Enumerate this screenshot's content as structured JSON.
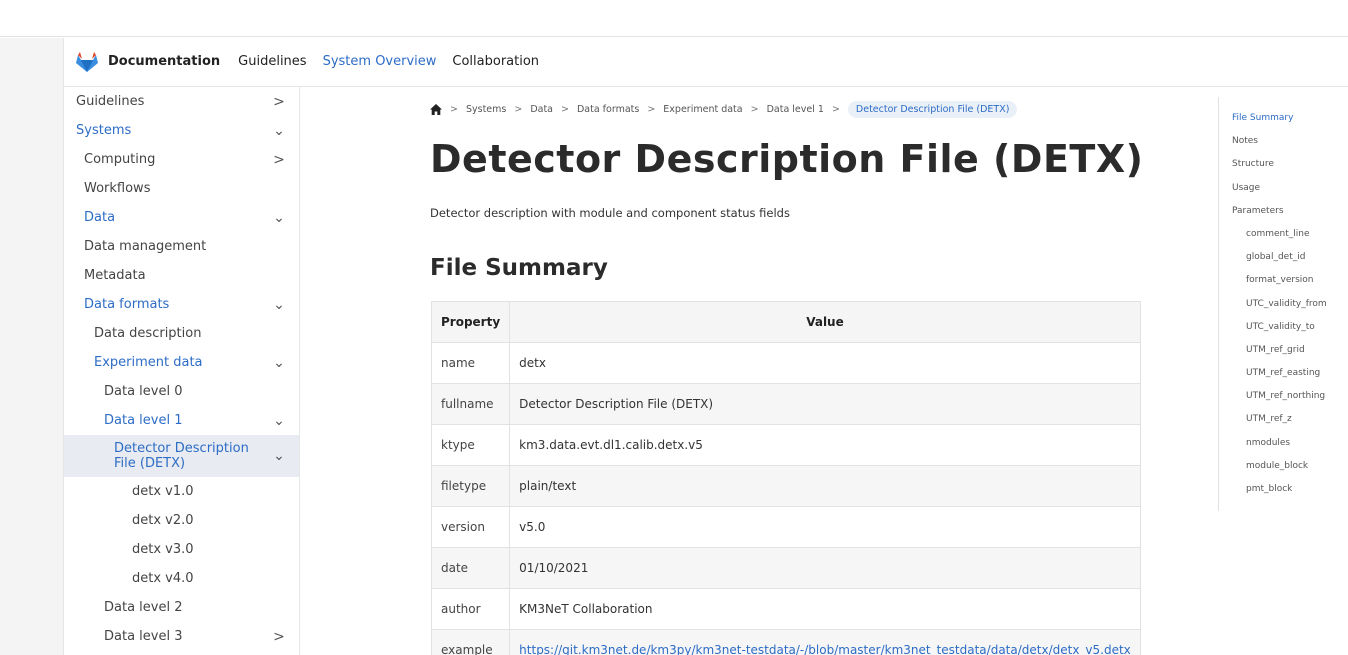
{
  "topnav": {
    "brand": "Documentation",
    "links": [
      {
        "label": "Guidelines",
        "active": false
      },
      {
        "label": "System Overview",
        "active": true
      },
      {
        "label": "Collaboration",
        "active": false
      }
    ]
  },
  "sidebar": {
    "items": [
      {
        "label": "Guidelines",
        "chevron": ">",
        "level": 0,
        "active": false
      },
      {
        "label": "Systems",
        "chevron": "⌄",
        "level": 0,
        "active": true
      },
      {
        "label": "Computing",
        "chevron": ">",
        "level": 1,
        "active": false
      },
      {
        "label": "Workflows",
        "chevron": "",
        "level": 1,
        "active": false
      },
      {
        "label": "Data",
        "chevron": "⌄",
        "level": 1,
        "active": true
      },
      {
        "label": "Data management",
        "chevron": "",
        "level": 2,
        "active": false
      },
      {
        "label": "Metadata",
        "chevron": "",
        "level": 2,
        "active": false
      },
      {
        "label": "Data formats",
        "chevron": "⌄",
        "level": 2,
        "active": true
      },
      {
        "label": "Data description",
        "chevron": "",
        "level": 3,
        "active": false
      },
      {
        "label": "Experiment data",
        "chevron": "⌄",
        "level": 3,
        "active": true
      },
      {
        "label": "Data level 0",
        "chevron": "",
        "level": 4,
        "active": false
      },
      {
        "label": "Data level 1",
        "chevron": "⌄",
        "level": 4,
        "active": true
      },
      {
        "label": "Detector Description File (DETX)",
        "chevron": "⌄",
        "level": 5,
        "active": true,
        "current": true
      },
      {
        "label": "detx v1.0",
        "chevron": "",
        "level": 6,
        "active": false
      },
      {
        "label": "detx v2.0",
        "chevron": "",
        "level": 6,
        "active": false
      },
      {
        "label": "detx v3.0",
        "chevron": "",
        "level": 6,
        "active": false
      },
      {
        "label": "detx v4.0",
        "chevron": "",
        "level": 6,
        "active": false
      },
      {
        "label": "Data level 2",
        "chevron": "",
        "level": 4,
        "active": false
      },
      {
        "label": "Data level 3",
        "chevron": ">",
        "level": 4,
        "active": false
      }
    ]
  },
  "breadcrumb": {
    "items": [
      "Systems",
      "Data",
      "Data formats",
      "Experiment data",
      "Data level 1"
    ],
    "current": "Detector Description File (DETX)",
    "separator": ">"
  },
  "page": {
    "title": "Detector Description File (DETX)",
    "subtitle": "Detector description with module and component status fields",
    "section_title": "File Summary"
  },
  "summary_table": {
    "headers": [
      "Property",
      "Value"
    ],
    "rows": [
      {
        "prop": "name",
        "value": "detx",
        "link": false
      },
      {
        "prop": "fullname",
        "value": "Detector Description File (DETX)",
        "link": false
      },
      {
        "prop": "ktype",
        "value": "km3.data.evt.dl1.calib.detx.v5",
        "link": false
      },
      {
        "prop": "filetype",
        "value": "plain/text",
        "link": false
      },
      {
        "prop": "version",
        "value": "v5.0",
        "link": false
      },
      {
        "prop": "date",
        "value": "01/10/2021",
        "link": false
      },
      {
        "prop": "author",
        "value": "KM3NeT Collaboration",
        "link": false
      },
      {
        "prop": "example",
        "value": "https://git.km3net.de/km3py/km3net-testdata/-/blob/master/km3net_testdata/data/detx/detx_v5.detx",
        "link": true
      }
    ]
  },
  "toc": {
    "items": [
      {
        "label": "File Summary",
        "sub": false,
        "active": true
      },
      {
        "label": "Notes",
        "sub": false,
        "active": false
      },
      {
        "label": "Structure",
        "sub": false,
        "active": false
      },
      {
        "label": "Usage",
        "sub": false,
        "active": false
      },
      {
        "label": "Parameters",
        "sub": false,
        "active": false
      },
      {
        "label": "comment_line",
        "sub": true,
        "active": false
      },
      {
        "label": "global_det_id",
        "sub": true,
        "active": false
      },
      {
        "label": "format_version",
        "sub": true,
        "active": false
      },
      {
        "label": "UTC_validity_from",
        "sub": true,
        "active": false
      },
      {
        "label": "UTC_validity_to",
        "sub": true,
        "active": false
      },
      {
        "label": "UTM_ref_grid",
        "sub": true,
        "active": false
      },
      {
        "label": "UTM_ref_easting",
        "sub": true,
        "active": false
      },
      {
        "label": "UTM_ref_northing",
        "sub": true,
        "active": false
      },
      {
        "label": "UTM_ref_z",
        "sub": true,
        "active": false
      },
      {
        "label": "nmodules",
        "sub": true,
        "active": false
      },
      {
        "label": "module_block",
        "sub": true,
        "active": false
      },
      {
        "label": "pmt_block",
        "sub": true,
        "active": false
      }
    ]
  },
  "colors": {
    "accent": "#2d6cc5",
    "logo_orange": "#e2432a",
    "logo_blue": "#3b8de0"
  }
}
